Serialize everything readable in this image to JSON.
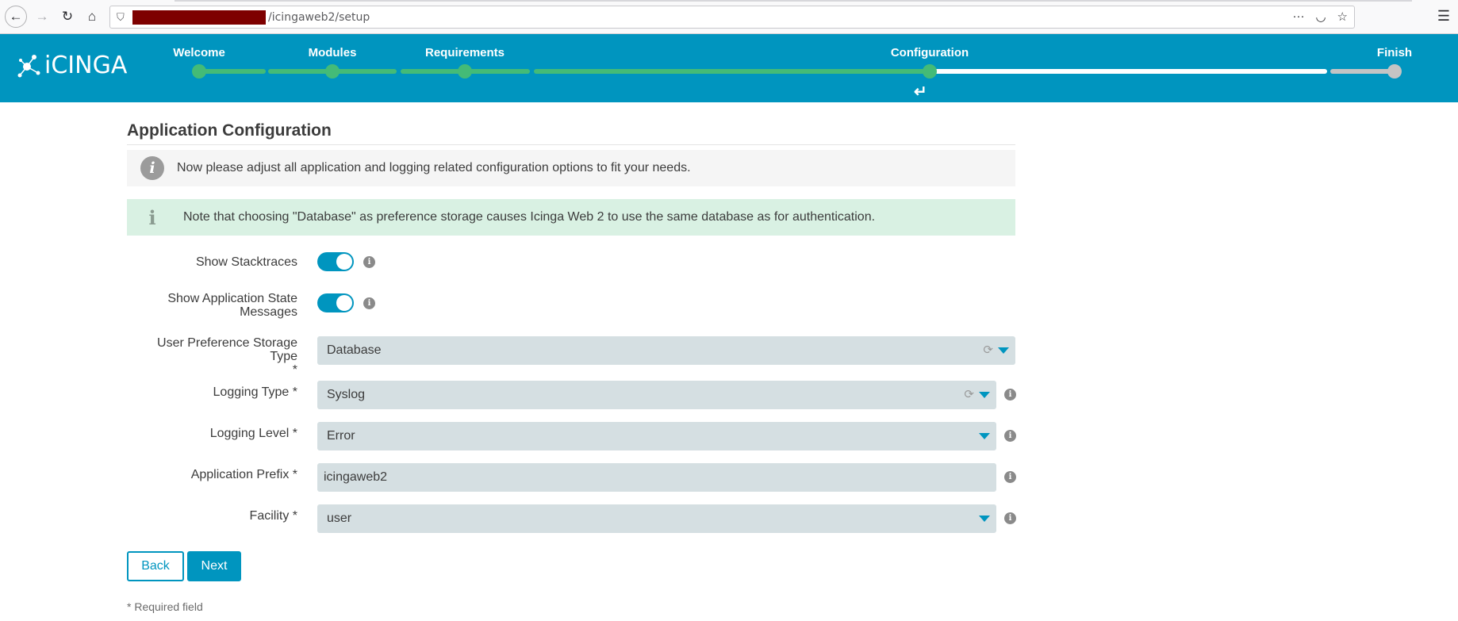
{
  "browser": {
    "url_path": "/icingaweb2/setup"
  },
  "header": {
    "logo_text": "iCINGA",
    "steps": [
      {
        "label": "Welcome",
        "state": "done"
      },
      {
        "label": "Modules",
        "state": "done"
      },
      {
        "label": "Requirements",
        "state": "done"
      },
      {
        "label": "Configuration",
        "state": "current"
      },
      {
        "label": "Finish",
        "state": "todo"
      }
    ]
  },
  "page": {
    "title": "Application Configuration",
    "info_text": "Now please adjust all application and logging related configuration options to fit your needs.",
    "note_text": "Note that choosing \"Database\" as preference storage causes Icinga Web 2 to use the same database as for authentication."
  },
  "form": {
    "show_stacktraces": {
      "label": "Show Stacktraces",
      "enabled": true
    },
    "show_app_state": {
      "label_line1": "Show Application State",
      "label_line2": "Messages",
      "enabled": true
    },
    "pref_storage": {
      "label_line1": "User Preference Storage Type",
      "label_line2": "*",
      "value": "Database"
    },
    "logging_type": {
      "label": "Logging Type *",
      "value": "Syslog"
    },
    "logging_level": {
      "label": "Logging Level *",
      "value": "Error"
    },
    "app_prefix": {
      "label": "Application Prefix *",
      "value": "icingaweb2"
    },
    "facility": {
      "label": "Facility *",
      "value": "user"
    }
  },
  "buttons": {
    "back": "Back",
    "next": "Next"
  },
  "footer": {
    "required_note": "* Required field"
  },
  "colors": {
    "brand": "#0095bf",
    "done": "#44bb77",
    "todo": "#c4c4c4"
  }
}
